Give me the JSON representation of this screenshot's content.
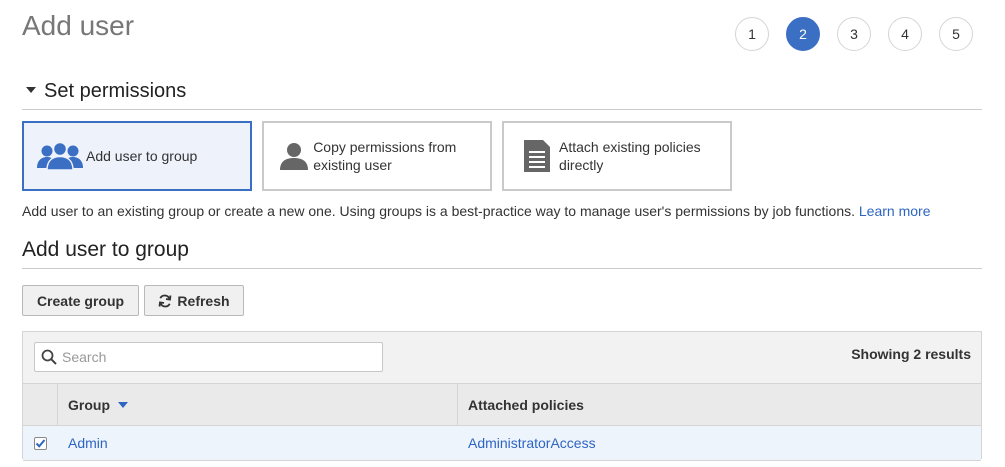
{
  "header": {
    "title": "Add user"
  },
  "steps": [
    "1",
    "2",
    "3",
    "4",
    "5"
  ],
  "active_step": "2",
  "set_permissions": {
    "title": "Set permissions",
    "options": [
      {
        "label": "Add user to group",
        "icon": "group-icon",
        "selected": true
      },
      {
        "label": "Copy permissions from existing user",
        "icon": "user-icon",
        "selected": false
      },
      {
        "label": "Attach existing policies directly",
        "icon": "document-icon",
        "selected": false
      }
    ],
    "description": "Add user to an existing group or create a new one. Using groups is a best-practice way to manage user's permissions by job functions.",
    "learn_more": "Learn more"
  },
  "add_to_group": {
    "title": "Add user to group",
    "create_group_label": "Create group",
    "refresh_label": "Refresh",
    "search": {
      "placeholder": "Search",
      "value": ""
    },
    "results_text": "Showing 2 results",
    "columns": {
      "group": "Group",
      "policies": "Attached policies"
    },
    "rows": [
      {
        "group": "Admin",
        "policies": "AdministratorAccess",
        "checked": true
      }
    ]
  },
  "colors": {
    "accent": "#3b6fc4",
    "link": "#2e65c0",
    "selected_bg": "#edf2fb"
  }
}
